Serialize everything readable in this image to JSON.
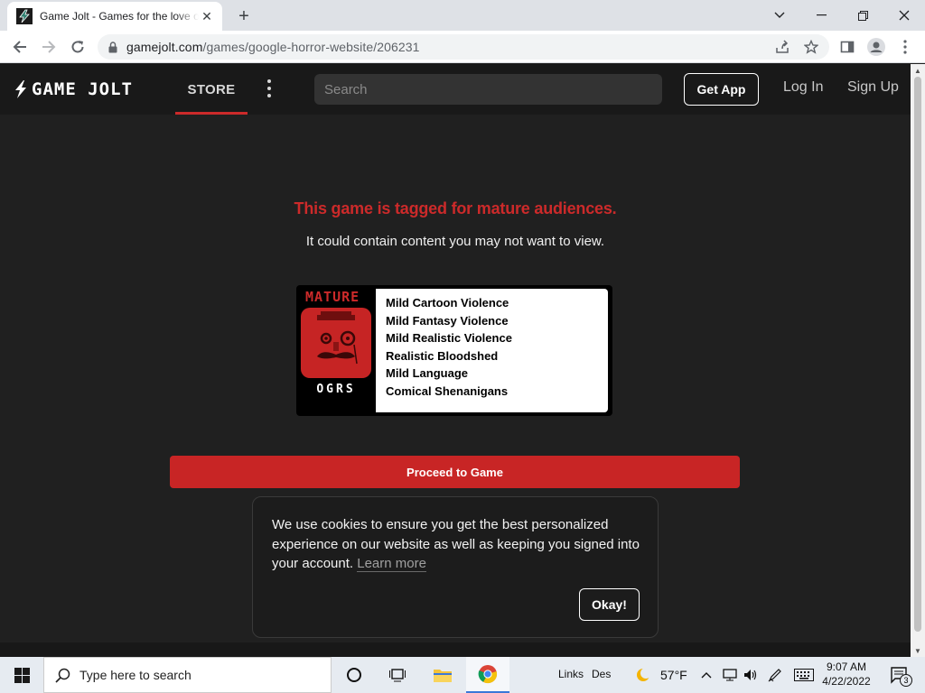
{
  "browser": {
    "tab_title": "Game Jolt - Games for the love of",
    "url_host": "gamejolt.com",
    "url_path": "/games/google-horror-website/206231",
    "new_tab_glyph": "+",
    "tab_close_glyph": "✕"
  },
  "site": {
    "logo_text": "GAME JOLT",
    "nav_store": "STORE",
    "search_placeholder": "Search",
    "get_app": "Get App",
    "login": "Log In",
    "signup": "Sign Up",
    "accent_color": "#cc2a2a"
  },
  "warning": {
    "title": "This game is tagged for mature audiences.",
    "subtitle": "It could contain content you may not want to view.",
    "rating_label": "MATURE",
    "rating_brand": "OGRS",
    "descriptors": [
      "Mild Cartoon Violence",
      "Mild Fantasy Violence",
      "Mild Realistic Violence",
      "Realistic Bloodshed",
      "Mild Language",
      "Comical Shenanigans"
    ],
    "proceed_label": "Proceed to Game"
  },
  "cookie": {
    "message": "We use cookies to ensure you get the best personalized experience on our website as well as keeping you signed into your account.",
    "learn_more": "Learn more",
    "ok_label": "Okay!"
  },
  "taskbar": {
    "search_placeholder": "Type here to search",
    "links_label": "Links",
    "des_label": "Des",
    "temperature": "57°F",
    "time": "9:07 AM",
    "date": "4/22/2022",
    "notification_count": "3"
  }
}
